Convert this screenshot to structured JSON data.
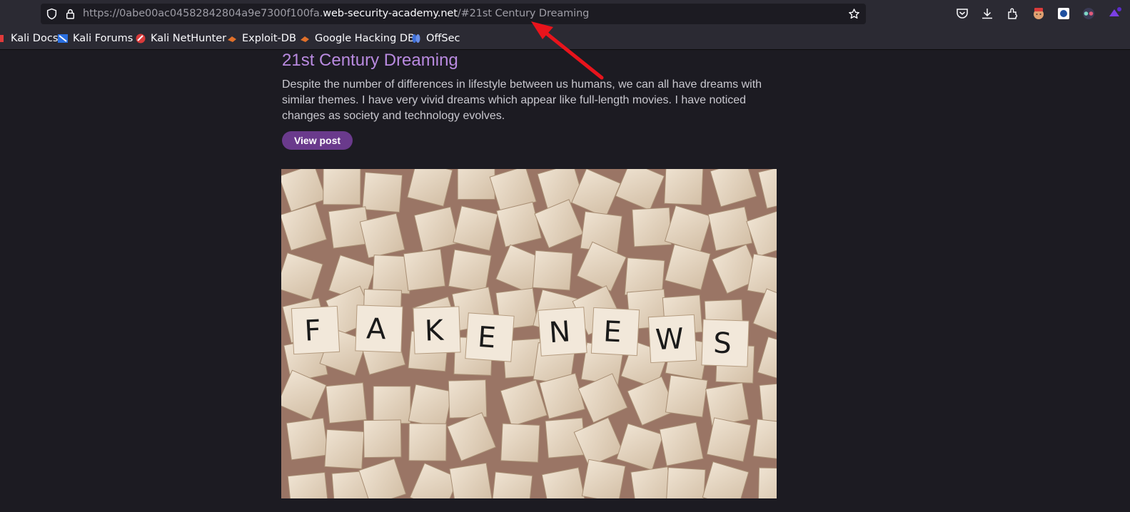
{
  "browser": {
    "url": {
      "prefix": "https://0abe00ac04582842804a9e7300f100fa.",
      "domain": "web-security-academy.net",
      "suffix": "/#21st Century Dreaming"
    },
    "toolbar_icons": [
      "shield-icon",
      "lock-icon",
      "star-icon",
      "pocket-icon",
      "download-icon",
      "extensions-icon",
      "profile-icon",
      "extension-blue-icon",
      "extension-glasses-icon",
      "extension-purple-icon"
    ]
  },
  "bookmarks": [
    {
      "label": "Kali Docs",
      "icon": "kali-docs-icon"
    },
    {
      "label": "Kali Forums",
      "icon": "kali-forums-icon"
    },
    {
      "label": "Kali NetHunter",
      "icon": "kali-nethunter-icon"
    },
    {
      "label": "Exploit-DB",
      "icon": "exploit-db-icon"
    },
    {
      "label": "Google Hacking DB",
      "icon": "google-hacking-db-icon"
    },
    {
      "label": "OffSec",
      "icon": "offsec-icon"
    }
  ],
  "post": {
    "title": "21st Century Dreaming",
    "summary": "Despite the number of differences in lifestyle between us humans, we can all have dreams with similar themes. I have very vivid dreams which appear like full-length movies. I have noticed changes as society and technology evolves.",
    "view_button": "View post",
    "image_tiles": [
      "F",
      "A",
      "K",
      "E",
      "N",
      "E",
      "W",
      "S"
    ]
  },
  "colors": {
    "title": "#b98ae0",
    "button": "#6a3a8c",
    "background": "#1c1b22",
    "annotation_arrow": "#e8141c"
  }
}
